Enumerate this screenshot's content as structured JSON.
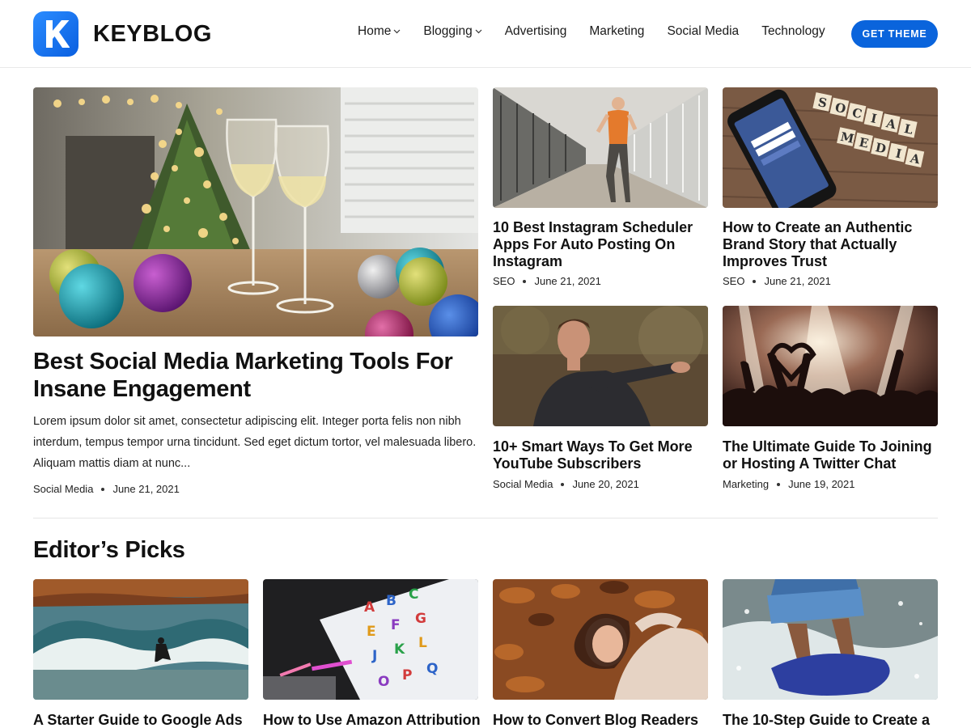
{
  "header": {
    "logo_letter": "K",
    "brand": "KEYBLOG",
    "nav": [
      {
        "label": "Home",
        "has_dropdown": true
      },
      {
        "label": "Blogging",
        "has_dropdown": true
      },
      {
        "label": "Advertising",
        "has_dropdown": false
      },
      {
        "label": "Marketing",
        "has_dropdown": false
      },
      {
        "label": "Social Media",
        "has_dropdown": false
      },
      {
        "label": "Technology",
        "has_dropdown": false
      }
    ],
    "cta_label": "GET THEME"
  },
  "featured": {
    "title": "Best Social Media Marketing Tools For Insane Engagement",
    "excerpt": "Lorem ipsum dolor sit amet, consectetur adipiscing elit. Integer porta felis non nibh interdum, tempus tempor urna tincidunt. Sed eget dictum tortor, vel malesuada libero. Aliquam mattis diam at nunc...",
    "category": "Social Media",
    "date": "June 21, 2021"
  },
  "grid_posts": [
    {
      "title": "10 Best Instagram Scheduler Apps For Auto Posting On Instagram",
      "category": "SEO",
      "date": "June 21, 2021"
    },
    {
      "title": "How to Create an Authentic Brand Story that Actually Improves Trust",
      "category": "SEO",
      "date": "June 21, 2021"
    },
    {
      "title": "10+ Smart Ways To Get More YouTube Subscribers",
      "category": "Social Media",
      "date": "June 20, 2021"
    },
    {
      "title": "The Ultimate Guide To Joining or Hosting A Twitter Chat",
      "category": "Marketing",
      "date": "June 19, 2021"
    }
  ],
  "editors_picks": {
    "heading": "Editor’s Picks",
    "posts": [
      {
        "title": "A Starter Guide to Google Ads"
      },
      {
        "title": "How to Use Amazon Attribution"
      },
      {
        "title": "How to Convert Blog Readers"
      },
      {
        "title": "The 10-Step Guide to Create a"
      }
    ]
  },
  "colors": {
    "accent": "#0a64dc",
    "text": "#111111",
    "divider": "#e6e6e6"
  },
  "icons": {
    "dropdown": "chevron-down-icon"
  }
}
